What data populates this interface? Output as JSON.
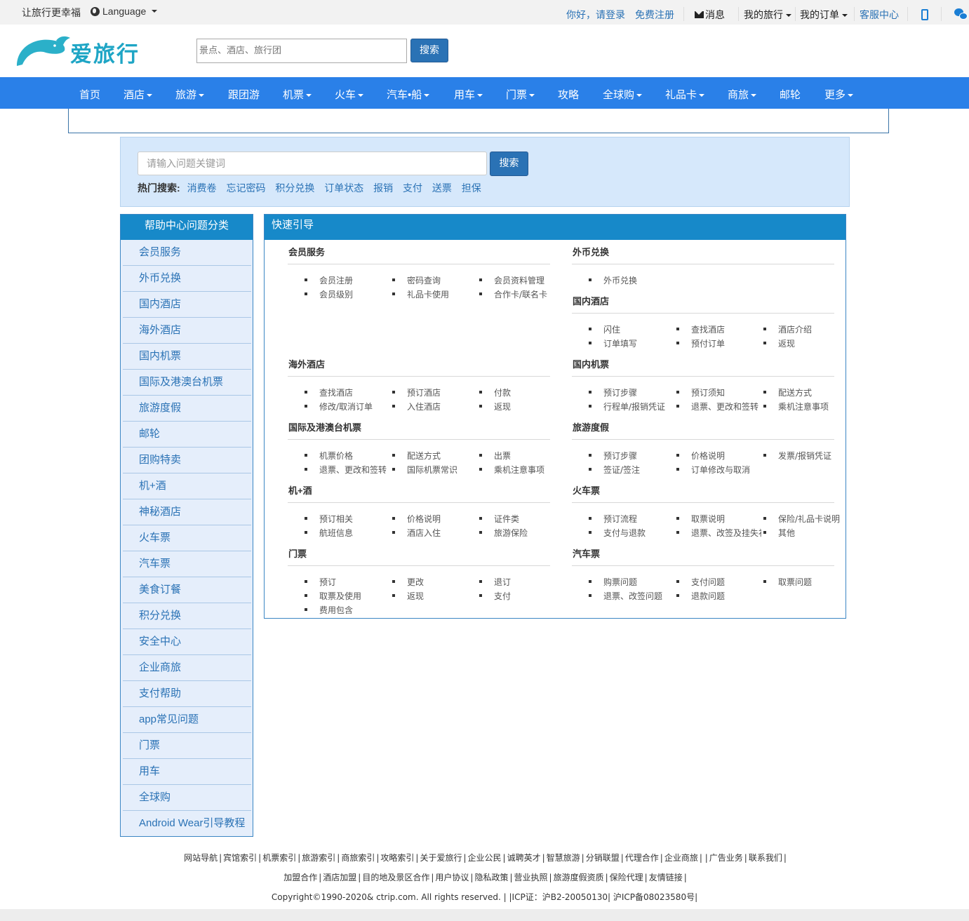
{
  "topbar": {
    "slogan": "让旅行更幸福",
    "language": "Language",
    "greeting": "你好，请登录",
    "register": "免费注册",
    "messages": "消息",
    "my_travel": "我的旅行",
    "my_orders": "我的订单",
    "service": "客服中心"
  },
  "header": {
    "logo_text": "爱旅行",
    "search_placeholder": "景点、酒店、旅行团",
    "search_button": "搜索"
  },
  "nav": {
    "items": [
      {
        "label": "首页"
      },
      {
        "label": "酒店"
      },
      {
        "label": "旅游"
      },
      {
        "label": "跟团游"
      },
      {
        "label": "机票"
      },
      {
        "label": "火车"
      },
      {
        "label": "汽车•船"
      },
      {
        "label": "用车"
      },
      {
        "label": "门票"
      },
      {
        "label": "攻略"
      },
      {
        "label": "全球购"
      },
      {
        "label": "礼品卡"
      },
      {
        "label": "商旅"
      },
      {
        "label": "邮轮"
      },
      {
        "label": "更多"
      }
    ]
  },
  "help_search": {
    "placeholder": "请输入问题关键词",
    "button": "搜索",
    "hot_label": "热门搜索:",
    "hot": [
      "消费卷",
      "忘记密码",
      "积分兑换",
      "订单状态",
      "报销",
      "支付",
      "送票",
      "担保"
    ]
  },
  "sidebar": {
    "title": "帮助中心问题分类",
    "items": [
      "会员服务",
      "外币兑换",
      "国内酒店",
      "海外酒店",
      "国内机票",
      "国际及港澳台机票",
      "旅游度假",
      "邮轮",
      "团购特卖",
      "机+酒",
      "神秘酒店",
      "火车票",
      "汽车票",
      "美食订餐",
      "积分兑换",
      "安全中心",
      "企业商旅",
      "支付帮助",
      "app常见问题",
      "门票",
      "用车",
      "全球购",
      "Android Wear引导教程"
    ]
  },
  "guide": {
    "title": "快速引导",
    "sections": [
      {
        "title": "会员服务",
        "links": [
          "会员注册",
          "密码查询",
          "会员资料管理",
          "会员级别",
          "礼品卡使用",
          "合作卡/联名卡"
        ]
      },
      {
        "title": "外币兑换",
        "links": [
          "外币兑换"
        ]
      },
      {
        "title": "国内酒店",
        "links": [
          "闪住",
          "查找酒店",
          "酒店介绍",
          "订单填写",
          "预付订单",
          "返现"
        ]
      },
      {
        "title": "海外酒店",
        "links": [
          "查找酒店",
          "预订酒店",
          "付款",
          "修改/取消订单",
          "入住酒店",
          "返现"
        ]
      },
      {
        "title": "国内机票",
        "links": [
          "预订步骤",
          "预订须知",
          "配送方式",
          "行程单/报销凭证",
          "退票、更改和签转",
          "乘机注意事项"
        ]
      },
      {
        "title": "国际及港澳台机票",
        "links": [
          "机票价格",
          "配送方式",
          "出票",
          "退票、更改和签转",
          "国际机票常识",
          "乘机注意事项"
        ]
      },
      {
        "title": "旅游度假",
        "links": [
          "预订步骤",
          "价格说明",
          "发票/报销凭证",
          "签证/签注",
          "订单修改与取消"
        ]
      },
      {
        "title": "机+酒",
        "links": [
          "预订相关",
          "价格说明",
          "证件类",
          "航班信息",
          "酒店入住",
          "旅游保险"
        ]
      },
      {
        "title": "火车票",
        "links": [
          "预订流程",
          "取票说明",
          "保险/礼品卡说明",
          "支付与退款",
          "退票、改签及挂失补办",
          "其他"
        ]
      },
      {
        "title": "门票",
        "links": [
          "预订",
          "更改",
          "退订",
          "取票及使用",
          "返现",
          "支付",
          "费用包含"
        ]
      },
      {
        "title": "汽车票",
        "links": [
          "购票问题",
          "支付问题",
          "取票问题",
          "退票、改签问题",
          "退款问题"
        ]
      }
    ]
  },
  "footer": {
    "row1": [
      "网站导航",
      "宾馆索引",
      "机票索引",
      "旅游索引",
      "商旅索引",
      "攻略索引",
      "关于爱旅行",
      "企业公民",
      "诚聘英才",
      "智慧旅游",
      "分销联盟",
      "代理合作",
      "企业商旅",
      "广告业务",
      "联系我们"
    ],
    "row2": [
      "加盟合作",
      "酒店加盟",
      "目的地及景区合作",
      "用户协议",
      "隐私政策",
      "营业执照",
      "旅游度假资质",
      "保险代理",
      "友情链接"
    ],
    "copyright": "Copyright©1990-2020& ctrip.com. All rights reserved. | |ICP证：沪B2-20050130| 沪ICP备08023580号|"
  },
  "colors": {
    "nav_blue": "#2a80e8",
    "panel_blue": "#1789c9",
    "link_blue": "#2a72b5",
    "logo_teal": "#1ea5c5"
  }
}
